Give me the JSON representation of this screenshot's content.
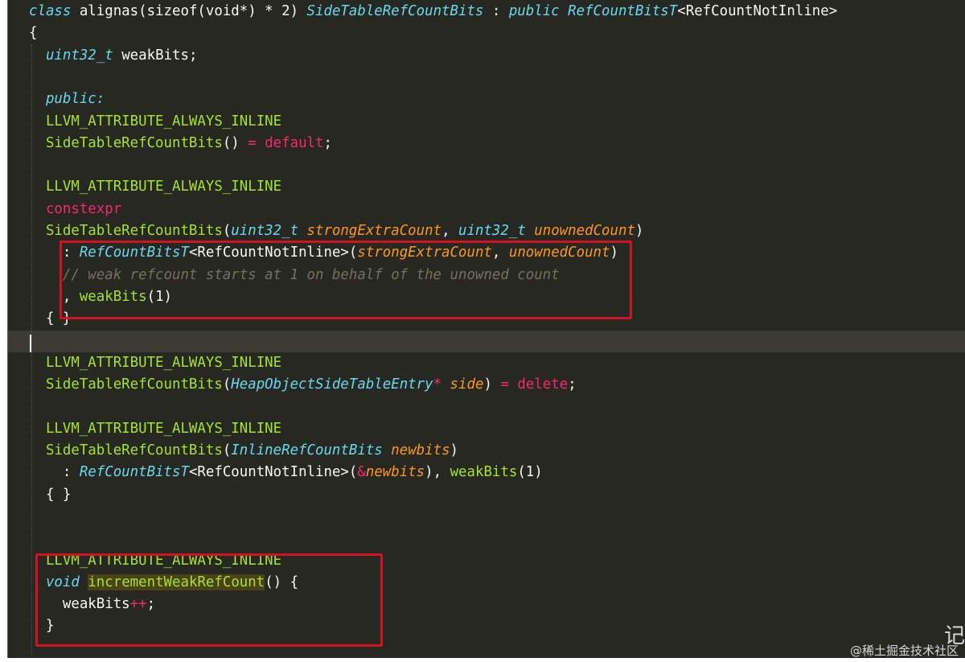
{
  "editor": {
    "theme_colors": {
      "background": "#272822",
      "keyword": "#66d9ef",
      "macro": "#a6e22e",
      "operator": "#f92672",
      "parameter": "#fd971f",
      "comment": "#75715e",
      "text": "#f8f8f2",
      "annotation_box": "#d0131f"
    },
    "lines": [
      {
        "tokens": [
          {
            "t": "class",
            "c": "keyword"
          },
          {
            "t": " alignas(sizeof(void*) * 2) ",
            "c": "plain"
          },
          {
            "t": "SideTableRefCountBits",
            "c": "class"
          },
          {
            "t": " : ",
            "c": "plain"
          },
          {
            "t": "public",
            "c": "keyword"
          },
          {
            "t": " ",
            "c": "plain"
          },
          {
            "t": "RefCountBitsT",
            "c": "class"
          },
          {
            "t": "<RefCountNotInline>",
            "c": "plain"
          }
        ]
      },
      {
        "tokens": [
          {
            "t": "{",
            "c": "plain"
          }
        ]
      },
      {
        "tokens": [
          {
            "t": "  ",
            "c": "plain"
          },
          {
            "t": "uint32_t",
            "c": "type"
          },
          {
            "t": " weakBits;",
            "c": "plain"
          }
        ]
      },
      {
        "tokens": []
      },
      {
        "tokens": [
          {
            "t": "  ",
            "c": "plain"
          },
          {
            "t": "public:",
            "c": "keyword"
          }
        ]
      },
      {
        "tokens": [
          {
            "t": "  LLVM_ATTRIBUTE_ALWAYS_INLINE",
            "c": "macro"
          }
        ]
      },
      {
        "tokens": [
          {
            "t": "  SideTableRefCountBits",
            "c": "func"
          },
          {
            "t": "() ",
            "c": "plain"
          },
          {
            "t": "=",
            "c": "op"
          },
          {
            "t": " ",
            "c": "plain"
          },
          {
            "t": "default",
            "c": "op"
          },
          {
            "t": ";",
            "c": "plain"
          }
        ]
      },
      {
        "tokens": []
      },
      {
        "tokens": [
          {
            "t": "  LLVM_ATTRIBUTE_ALWAYS_INLINE",
            "c": "macro"
          }
        ]
      },
      {
        "tokens": [
          {
            "t": "  constexpr",
            "c": "op"
          }
        ]
      },
      {
        "tokens": [
          {
            "t": "  SideTableRefCountBits",
            "c": "func"
          },
          {
            "t": "(",
            "c": "plain"
          },
          {
            "t": "uint32_t",
            "c": "type"
          },
          {
            "t": " ",
            "c": "plain"
          },
          {
            "t": "strongExtraCount",
            "c": "param"
          },
          {
            "t": ", ",
            "c": "plain"
          },
          {
            "t": "uint32_t",
            "c": "type"
          },
          {
            "t": " ",
            "c": "plain"
          },
          {
            "t": "unownedCount",
            "c": "param"
          },
          {
            "t": ")",
            "c": "plain"
          }
        ]
      },
      {
        "tokens": [
          {
            "t": "    : ",
            "c": "plain"
          },
          {
            "t": "RefCountBitsT",
            "c": "class"
          },
          {
            "t": "<RefCountNotInline>(",
            "c": "plain"
          },
          {
            "t": "strongExtraCount",
            "c": "param"
          },
          {
            "t": ", ",
            "c": "plain"
          },
          {
            "t": "unownedCount",
            "c": "param"
          },
          {
            "t": ")",
            "c": "plain"
          }
        ]
      },
      {
        "tokens": [
          {
            "t": "    // weak refcount starts at 1 on behalf of the unowned count",
            "c": "comment"
          }
        ]
      },
      {
        "tokens": [
          {
            "t": "    , ",
            "c": "plain"
          },
          {
            "t": "weakBits",
            "c": "func"
          },
          {
            "t": "(1)",
            "c": "plain"
          }
        ]
      },
      {
        "tokens": [
          {
            "t": "  { }",
            "c": "plain"
          }
        ]
      },
      {
        "tokens": [],
        "cursor": true
      },
      {
        "tokens": [
          {
            "t": "  LLVM_ATTRIBUTE_ALWAYS_INLINE",
            "c": "macro"
          }
        ]
      },
      {
        "tokens": [
          {
            "t": "  SideTableRefCountBits",
            "c": "func"
          },
          {
            "t": "(",
            "c": "plain"
          },
          {
            "t": "HeapObjectSideTableEntry",
            "c": "class"
          },
          {
            "t": "*",
            "c": "op"
          },
          {
            "t": " ",
            "c": "plain"
          },
          {
            "t": "side",
            "c": "param"
          },
          {
            "t": ") ",
            "c": "plain"
          },
          {
            "t": "=",
            "c": "op"
          },
          {
            "t": " ",
            "c": "plain"
          },
          {
            "t": "delete",
            "c": "op"
          },
          {
            "t": ";",
            "c": "plain"
          }
        ]
      },
      {
        "tokens": []
      },
      {
        "tokens": [
          {
            "t": "  LLVM_ATTRIBUTE_ALWAYS_INLINE",
            "c": "macro"
          }
        ]
      },
      {
        "tokens": [
          {
            "t": "  SideTableRefCountBits",
            "c": "func"
          },
          {
            "t": "(",
            "c": "plain"
          },
          {
            "t": "InlineRefCountBits",
            "c": "class"
          },
          {
            "t": " ",
            "c": "plain"
          },
          {
            "t": "newbits",
            "c": "param"
          },
          {
            "t": ")",
            "c": "plain"
          }
        ]
      },
      {
        "tokens": [
          {
            "t": "    : ",
            "c": "plain"
          },
          {
            "t": "RefCountBitsT",
            "c": "class"
          },
          {
            "t": "<RefCountNotInline>(",
            "c": "plain"
          },
          {
            "t": "&",
            "c": "op"
          },
          {
            "t": "newbits",
            "c": "param"
          },
          {
            "t": "), ",
            "c": "plain"
          },
          {
            "t": "weakBits",
            "c": "func"
          },
          {
            "t": "(1)",
            "c": "plain"
          }
        ]
      },
      {
        "tokens": [
          {
            "t": "  { }",
            "c": "plain"
          }
        ]
      },
      {
        "tokens": []
      },
      {
        "tokens": []
      },
      {
        "tokens": [
          {
            "t": "  LLVM_ATTRIBUTE_ALWAYS_INLINE",
            "c": "macro"
          }
        ]
      },
      {
        "tokens": [
          {
            "t": "  ",
            "c": "plain"
          },
          {
            "t": "void",
            "c": "keyword"
          },
          {
            "t": " ",
            "c": "plain"
          },
          {
            "t": "incrementWeakRefCount",
            "c": "highlight"
          },
          {
            "t": "() {",
            "c": "plain"
          }
        ]
      },
      {
        "tokens": [
          {
            "t": "    weakBits",
            "c": "plain"
          },
          {
            "t": "++",
            "c": "op"
          },
          {
            "t": ";",
            "c": "plain"
          }
        ]
      },
      {
        "tokens": [
          {
            "t": "  }",
            "c": "plain"
          }
        ]
      }
    ]
  },
  "watermark": "@稀土掘金技术社区",
  "corner_glyph": "记"
}
